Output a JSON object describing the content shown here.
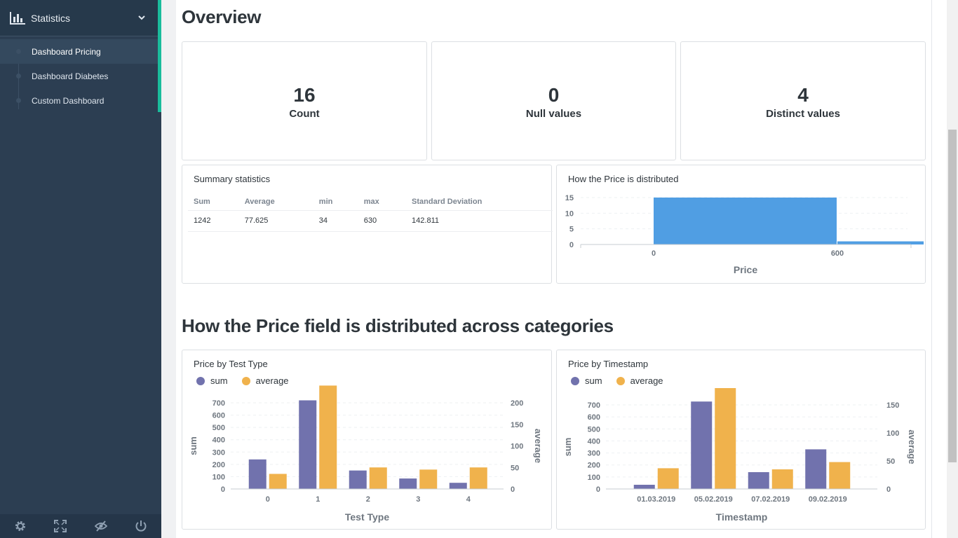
{
  "sidebar": {
    "section_title": "Statistics",
    "items": [
      {
        "label": "Dashboard Pricing",
        "active": true
      },
      {
        "label": "Dashboard Diabetes",
        "active": false
      },
      {
        "label": "Custom Dashboard",
        "active": false
      }
    ],
    "footer_icons": [
      "gear-icon",
      "fullscreen-icon",
      "eye-slash-icon",
      "power-icon"
    ],
    "accent_color": "#1abc9c"
  },
  "overview": {
    "title": "Overview",
    "stats": [
      {
        "value": "16",
        "label": "Count"
      },
      {
        "value": "0",
        "label": "Null values"
      },
      {
        "value": "4",
        "label": "Distinct values"
      }
    ]
  },
  "summary": {
    "title": "Summary statistics",
    "headers": [
      "Sum",
      "Average",
      "min",
      "max",
      "Standard Deviation"
    ],
    "rows": [
      [
        "1242",
        "77.625",
        "34",
        "630",
        "142.811"
      ]
    ]
  },
  "distribution": {
    "title": "How the Price is distributed",
    "xlabel": "Price",
    "x_ticks": [
      "0",
      "600"
    ],
    "y_ticks": [
      "0",
      "5",
      "10",
      "15"
    ]
  },
  "categories": {
    "title": "How the Price field is distributed across categories",
    "legend": {
      "sum": "sum",
      "average": "average"
    },
    "colors": {
      "sum": "#7172ad",
      "average": "#f0b24c",
      "hist": "#509ee3"
    }
  },
  "chart_data": [
    {
      "type": "bar",
      "title": "How the Price is distributed",
      "xlabel": "Price",
      "ylabel": "",
      "bins": [
        {
          "from": 0,
          "to": 600,
          "count": 15
        },
        {
          "from": 600,
          "to": 1000,
          "count": 1
        }
      ],
      "ylim": [
        0,
        15
      ]
    },
    {
      "type": "bar",
      "title": "Price by Test Type",
      "xlabel": "Test Type",
      "ylabel": "sum",
      "y2label": "average",
      "categories": [
        "0",
        "1",
        "2",
        "3",
        "4"
      ],
      "series": [
        {
          "name": "sum",
          "axis": "left",
          "values": [
            240,
            720,
            150,
            85,
            50
          ]
        },
        {
          "name": "average",
          "axis": "right",
          "values": [
            35,
            240,
            50,
            45,
            50
          ]
        }
      ],
      "ylim": [
        0,
        700
      ],
      "y_ticks": [
        0,
        100,
        200,
        300,
        400,
        500,
        600,
        700
      ],
      "y2lim": [
        0,
        200
      ],
      "y2_ticks": [
        0,
        50,
        100,
        150,
        200
      ]
    },
    {
      "type": "bar",
      "title": "Price by Timestamp",
      "xlabel": "Timestamp",
      "ylabel": "sum",
      "y2label": "average",
      "categories": [
        "01.03.2019",
        "05.02.2019",
        "07.02.2019",
        "09.02.2019"
      ],
      "series": [
        {
          "name": "sum",
          "axis": "left",
          "values": [
            35,
            730,
            140,
            330
          ]
        },
        {
          "name": "average",
          "axis": "right",
          "values": [
            37,
            180,
            35,
            48
          ]
        }
      ],
      "ylim": [
        0,
        700
      ],
      "y_ticks": [
        0,
        100,
        200,
        300,
        400,
        500,
        600,
        700
      ],
      "y2lim": [
        0,
        150
      ],
      "y2_ticks": [
        0,
        50,
        100,
        150
      ]
    }
  ]
}
